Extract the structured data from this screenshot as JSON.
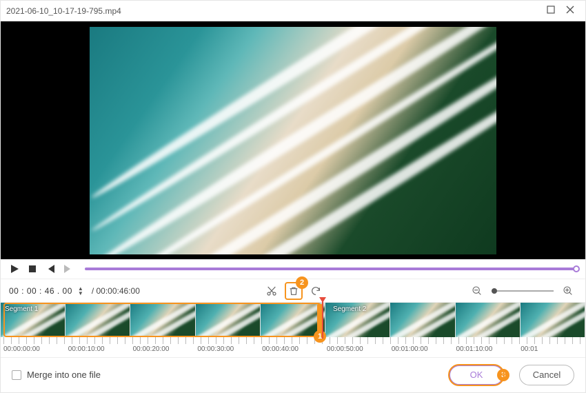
{
  "window": {
    "title": "2021-06-10_10-17-19-795.mp4"
  },
  "time": {
    "current": "00 : 00 : 46 . 00",
    "duration": "/ 00:00:46:00"
  },
  "segments": {
    "seg1": "Segment 1",
    "seg2": "Segment 2"
  },
  "ruler": [
    "00:00:00:00",
    "00:00:10:00",
    "00:00:20:00",
    "00:00:30:00",
    "00:00:40:00",
    "00:00:50:00",
    "00:01:00:00",
    "00:01:10:00",
    "00:01"
  ],
  "footer": {
    "merge": "Merge into one file",
    "ok": "OK",
    "cancel": "Cancel"
  },
  "annotations": {
    "a1": "1",
    "a2": "2",
    "a3": "3"
  },
  "colors": {
    "accent": "#a87bd8",
    "highlight": "#f7941e"
  }
}
